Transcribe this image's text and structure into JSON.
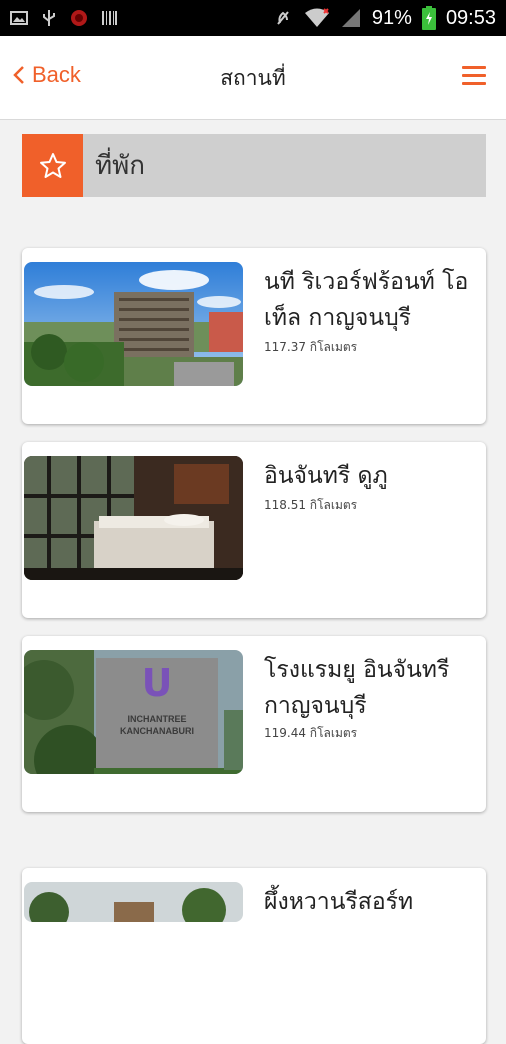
{
  "status_bar": {
    "battery": "91%",
    "time": "09:53",
    "icons": [
      "image-icon",
      "usb-icon",
      "app-icon",
      "barcode-icon",
      "mute-icon",
      "wifi-icon",
      "signal-icon",
      "battery-icon"
    ]
  },
  "header": {
    "back_label": "Back",
    "title": "สถานที่",
    "accent_color": "#f0602a"
  },
  "section": {
    "label": "ที่พัก"
  },
  "places": [
    {
      "name": "นที ริเวอร์ฟร้อนท์ โอเท็ล กาญจนบุรี",
      "distance": "117.37 กิโลเมตร"
    },
    {
      "name": "อินจันทรี ดูภู",
      "distance": "118.51 กิโลเมตร"
    },
    {
      "name": "โรงแรมยู อินจันทรี กาญจนบุรี",
      "distance": "119.44 กิโลเมตร",
      "sign_line1": "INCHANTREE",
      "sign_line2": "KANCHANABURI"
    },
    {
      "name": "ผึ้งหวานรีสอร์ท"
    }
  ]
}
